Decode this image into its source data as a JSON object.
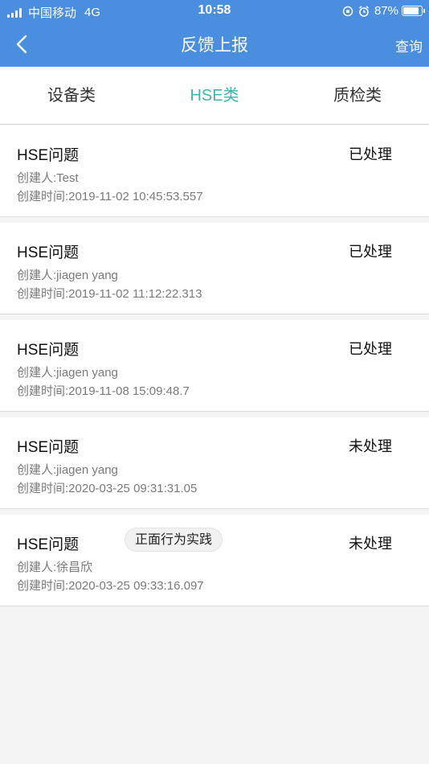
{
  "status_bar": {
    "carrier": "中国移动",
    "network": "4G",
    "time": "10:58",
    "battery_text": "87%",
    "battery_level": 0.87
  },
  "nav": {
    "title": "反馈上报",
    "query_label": "查询",
    "back_icon": "chevron-left-icon"
  },
  "tabs": [
    {
      "label": "设备类",
      "active": false
    },
    {
      "label": "HSE类",
      "active": true
    },
    {
      "label": "质检类",
      "active": false
    }
  ],
  "colors": {
    "header": "#4a8ee0",
    "active_tab": "#3cb6a8"
  },
  "items": [
    {
      "title": "HSE问题",
      "status": "已处理",
      "tag": "",
      "creator": "创建人:Test",
      "time": "创建时间:2019-11-02 10:45:53.557"
    },
    {
      "title": "HSE问题",
      "status": "已处理",
      "tag": "",
      "creator": "创建人:jiagen yang",
      "time": "创建时间:2019-11-02 11:12:22.313"
    },
    {
      "title": "HSE问题",
      "status": "已处理",
      "tag": "",
      "creator": "创建人:jiagen yang",
      "time": "创建时间:2019-11-08 15:09:48.7"
    },
    {
      "title": "HSE问题",
      "status": "未处理",
      "tag": "",
      "creator": "创建人:jiagen yang",
      "time": "创建时间:2020-03-25 09:31:31.05"
    },
    {
      "title": "HSE问题",
      "status": "未处理",
      "tag": "正面行为实践",
      "creator": "创建人:徐昌欣",
      "time": "创建时间:2020-03-25 09:33:16.097"
    }
  ]
}
